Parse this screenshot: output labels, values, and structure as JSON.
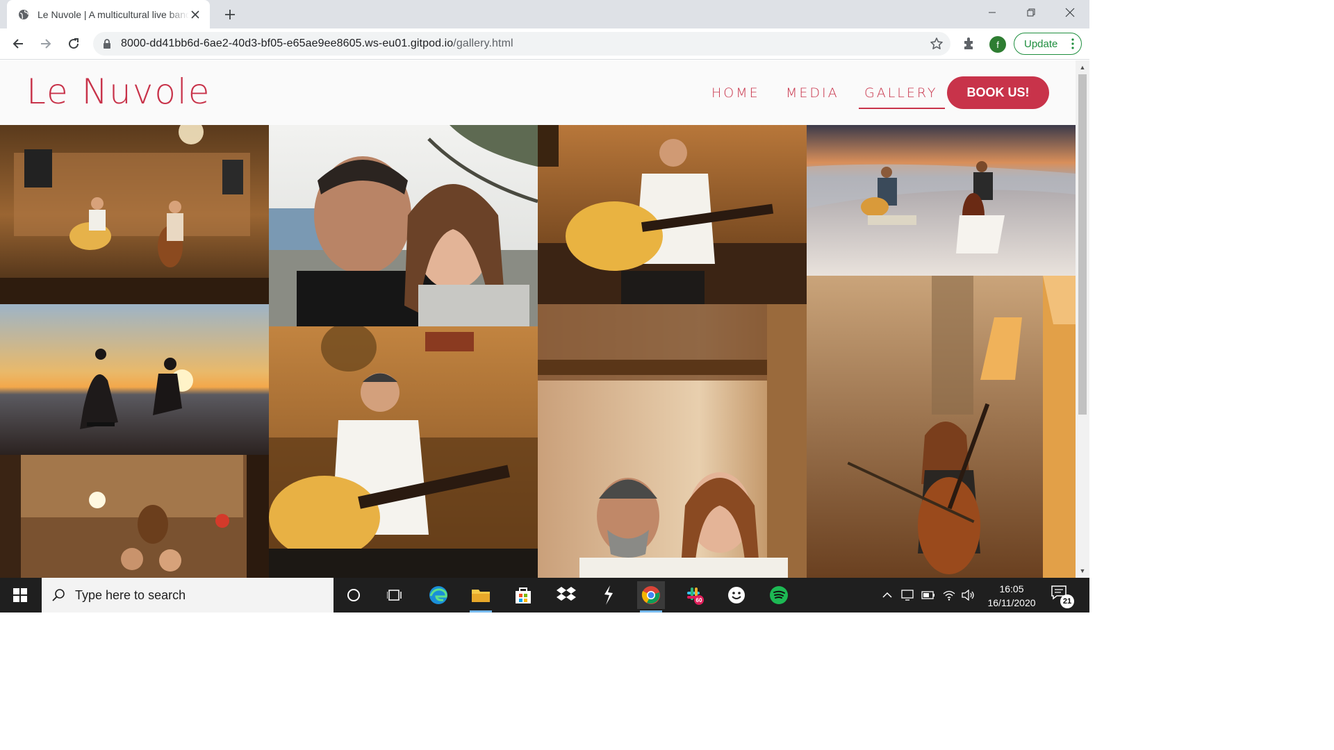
{
  "browser": {
    "tab_title": "Le Nuvole | A multicultural live band",
    "url_host": "8000-dd41bb6d-6ae2-40d3-bf05-e65ae9ee8605.ws-eu01.gitpod.io",
    "url_path": "/gallery.html",
    "profile_initial": "f",
    "update_label": "Update"
  },
  "site": {
    "logo": "Le Nuvole",
    "nav": {
      "home": "HOME",
      "media": "MEDIA",
      "gallery": "GALLERY",
      "book": "BOOK US!"
    },
    "colors": {
      "brand": "#c8334a"
    }
  },
  "gallery": {
    "photos": [
      "duo-performing-indoor-bar",
      "couple-selfie-by-sea",
      "guitarist-playing-brick-wall",
      "duo-playing-on-beach",
      "duo-silhouette-sunset-beach",
      "guitarist-closeup-brick-wall",
      "couple-portrait-brick-wall",
      "cellist-playing-lamp",
      "couple-in-bar-interior"
    ]
  },
  "taskbar": {
    "search_placeholder": "Type here to search",
    "time": "16:05",
    "date": "16/11/2020",
    "notification_count": "21",
    "slack_badge": "60"
  }
}
